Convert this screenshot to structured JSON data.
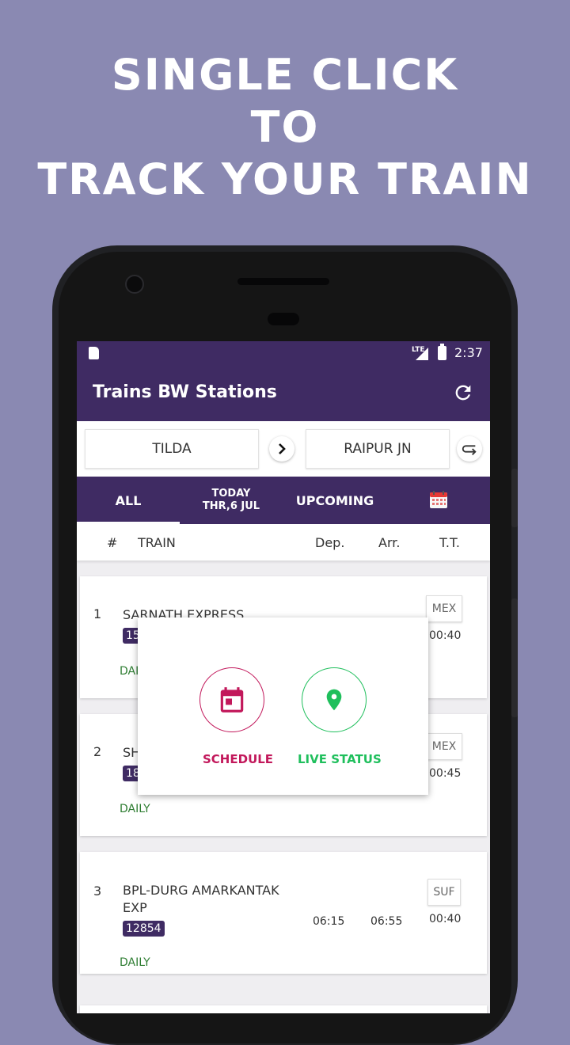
{
  "colors": {
    "background": "#8a89b2",
    "primary_dark": "#3f2b63",
    "primary": "#4a3270",
    "accent_pink": "#c2185b",
    "accent_green": "#1fbf5c",
    "days_green": "#2e7d32"
  },
  "headline": [
    "SINGLE CLICK",
    "TO",
    "TRACK YOUR TRAIN"
  ],
  "status_bar": {
    "network": "LTE",
    "time": "2:37"
  },
  "app_bar": {
    "title": "Trains BW Stations",
    "refresh_icon": "refresh-icon"
  },
  "route": {
    "from": "TILDA",
    "to": "RAIPUR JN"
  },
  "tabs": {
    "all": "ALL",
    "today_line1": "TODAY",
    "today_line2": "THR,6 JUL",
    "upcoming": "UPCOMING",
    "calendar_icon": "calendar-icon"
  },
  "columns": {
    "index": "#",
    "train": "TRAIN",
    "dep": "Dep.",
    "arr": "Arr.",
    "tt": "T.T."
  },
  "trains": [
    {
      "index": "1",
      "name": "SARNATH EXPRESS",
      "number": "15",
      "days": "DAI",
      "class": "MEX",
      "tt": "00:40"
    },
    {
      "index": "2",
      "name": "SH",
      "number": "18",
      "days": "DAILY",
      "class": "MEX",
      "tt": "00:45"
    },
    {
      "index": "3",
      "name": "BPL-DURG AMARKANTAK EXP",
      "number": "12854",
      "days": "DAILY",
      "class": "SUF",
      "dep": "06:15",
      "arr": "06:55",
      "tt": "00:40"
    }
  ],
  "popup": {
    "schedule_label": "SCHEDULE",
    "live_status_label": "LIVE STATUS"
  }
}
